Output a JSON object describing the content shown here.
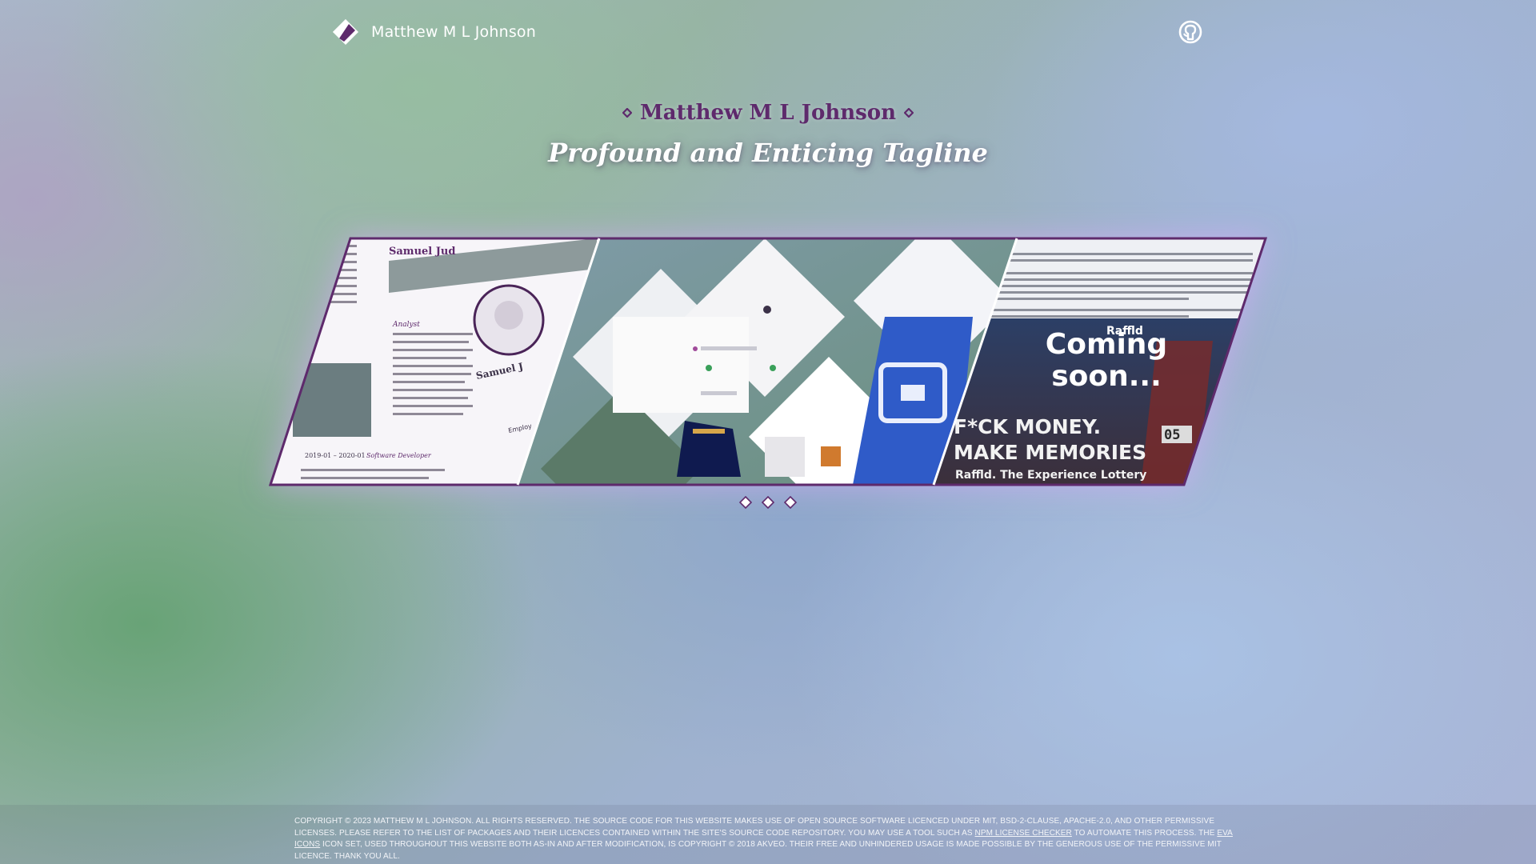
{
  "header": {
    "brand_name": "Matthew M L Johnson",
    "logo_icon": "diamond-logo-icon",
    "github_icon": "github-icon"
  },
  "hero": {
    "title": "Matthew M L Johnson",
    "tagline": "Profound and Enticing Tagline",
    "accent_color": "#5e2a6c"
  },
  "carousel": {
    "slides": [
      {
        "kind": "resume-preview",
        "texts": [
          "Samuel Jud",
          "Samuel J",
          "Analyst",
          "Software Developer",
          "2019-01 – 2020-01",
          "Employ"
        ]
      },
      {
        "kind": "component-preview",
        "texts": []
      },
      {
        "kind": "raffld-preview",
        "texts": [
          "Raffld",
          "Coming",
          "soon...",
          "F*CK MONEY.",
          "MAKE MEMORIES",
          "Raffld. The Experience Lottery",
          "05"
        ]
      }
    ],
    "indicators": 3
  },
  "footer": {
    "text_1": "Copyright © 2023 Matthew M L Johnson. All rights reserved. The source code for this website makes use of open source software licenced under MIT, BSD-2-Clause, Apache-2.0, and other permissive licenses. Please refer to the list of packages and their licences contained within the site's source code repository. You may use a tool such as ",
    "link_1": "npm license checker",
    "text_2": " to automate this process. The ",
    "link_2": "Eva Icons",
    "text_3": " icon set, used throughout this website both as-in and after modification, is copyright © 2018 Akveo. Their free and unhindered usage is made possible by the generous use of the permissive MIT licence. Thank you all."
  }
}
